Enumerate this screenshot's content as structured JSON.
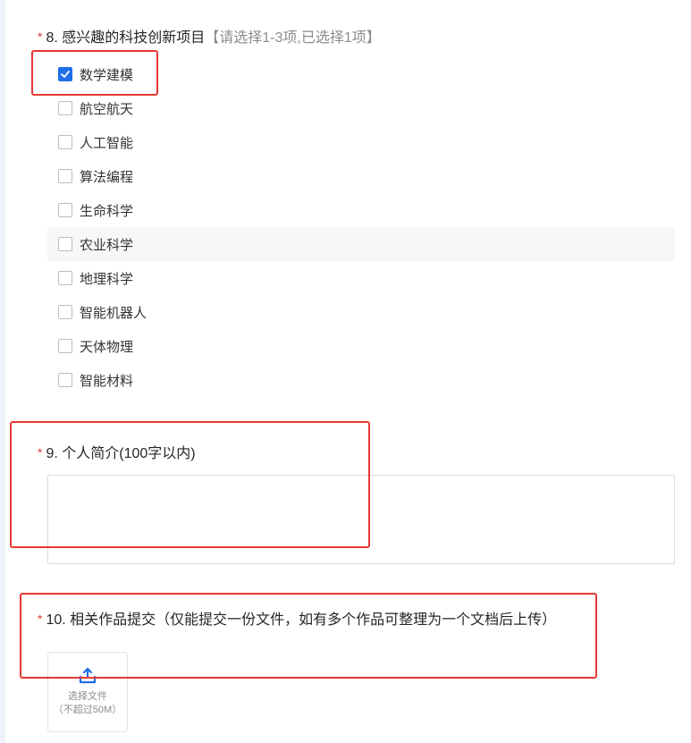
{
  "q8": {
    "required": "*",
    "title": "8. 感兴趣的科技创新项目",
    "hint": "【请选择1-3项,已选择1项】",
    "options": [
      {
        "label": "数学建模",
        "checked": true
      },
      {
        "label": "航空航天",
        "checked": false
      },
      {
        "label": "人工智能",
        "checked": false
      },
      {
        "label": "算法编程",
        "checked": false
      },
      {
        "label": "生命科学",
        "checked": false
      },
      {
        "label": "农业科学",
        "checked": false
      },
      {
        "label": "地理科学",
        "checked": false
      },
      {
        "label": "智能机器人",
        "checked": false
      },
      {
        "label": "天体物理",
        "checked": false
      },
      {
        "label": "智能材料",
        "checked": false
      }
    ]
  },
  "q9": {
    "required": "*",
    "title": "9. 个人简介(100字以内)",
    "value": ""
  },
  "q10": {
    "required": "*",
    "title": "10. 相关作品提交（仅能提交一份文件，如有多个作品可整理为一个文档后上传）",
    "upload": {
      "label": "选择文件",
      "limit": "（不超过50M）",
      "icon": "upload-icon"
    }
  },
  "colors": {
    "accent": "#1e6fe8",
    "required": "#e23a3a",
    "highlight_box": "#e53935"
  }
}
